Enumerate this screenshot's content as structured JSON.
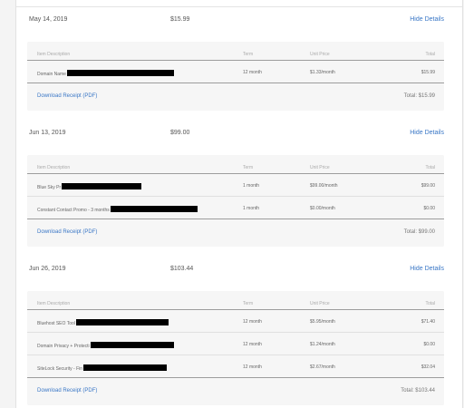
{
  "columns": {
    "desc": "Item Description",
    "term": "Term",
    "unit": "Unit Price",
    "total": "Total"
  },
  "hide_details_label": "Hide Details",
  "receipt_label": "Download Receipt (PDF)",
  "orders": [
    {
      "date": "May 14, 2019",
      "amount": "$15.99",
      "items": [
        {
          "desc": "Domain Name",
          "term": "12 month",
          "unit": "$1.33/month",
          "total": "$15.99"
        }
      ],
      "total_label": "Total: $15.99"
    },
    {
      "date": "Jun 13, 2019",
      "amount": "$99.00",
      "items": [
        {
          "desc": "Blue Sky Pr",
          "term": "1 month",
          "unit": "$99.00/month",
          "total": "$99.00"
        },
        {
          "desc": "Constant Contact Promo - 3 months",
          "term": "1 month",
          "unit": "$0.00/month",
          "total": "$0.00"
        }
      ],
      "total_label": "Total: $99.00"
    },
    {
      "date": "Jun 26, 2019",
      "amount": "$103.44",
      "items": [
        {
          "desc": "Bluehost SEO Tool",
          "term": "12 month",
          "unit": "$5.95/month",
          "total": "$71.40"
        },
        {
          "desc": "Domain Privacy + Protecti",
          "term": "12 month",
          "unit": "$1.24/month",
          "total": "$0.00"
        },
        {
          "desc": "SiteLock Security - Fin",
          "term": "12 month",
          "unit": "$2.67/month",
          "total": "$32.04"
        }
      ],
      "total_label": "Total: $103.44"
    }
  ]
}
